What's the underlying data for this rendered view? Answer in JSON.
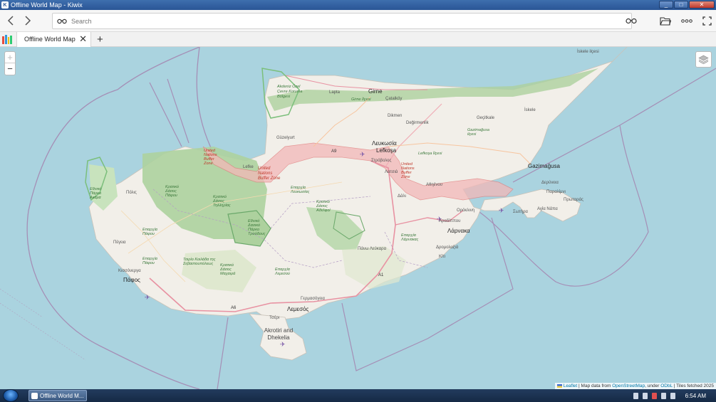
{
  "window": {
    "title": "Offline World Map - Kiwix"
  },
  "toolbar": {
    "search_placeholder": "Search"
  },
  "tabs": [
    {
      "label": "Offline World Map"
    }
  ],
  "map": {
    "zoom_in": "+",
    "zoom_out": "−",
    "attribution": {
      "leaflet": "Leaflet",
      "sep1": " | Map data from ",
      "osm": "OpenStreetMap",
      "sep2": ", under ",
      "odbl": "ODbL",
      "tail": " | Tiles fetched 2025"
    },
    "labels": {
      "girne": "Girne",
      "girne_ilcesi": "Girne İlçesi",
      "lapta": "Lapta",
      "catalkoy": "Çatalköy",
      "iskele_ilcesi": "İskele ilçesi",
      "iskele": "İskele",
      "gecitkale": "Geçitkale",
      "dikmen": "Dikmen",
      "degirmenlik": "Değirmenlik",
      "gazimagusa_ilcesi": "Gazimağusa ilçesi",
      "guzelyurt": "Güzelyurt",
      "akdeniz": "Akdeniz Özel Çevre Koruma Bölgesi",
      "lefkosia_gr": "Λευκωσία",
      "lefkosa": "Lefkoşa",
      "lefkosa_ilcesi": "Lefkoşa İlçesi",
      "strovolos": "Στρόβολος",
      "gazimagusa": "Gazimağusa",
      "dherynia": "Δερύνεια",
      "paralimni": "Παραλίμνι",
      "protaras": "Πρωταράς",
      "ayia_napa": "Αγία Νάπα",
      "sotira": "Σωτήρα",
      "orokleni": "Ορόκλινη",
      "larnaka": "Λάρνακα",
      "lefka": "Lefke",
      "un_buffer_1": "United Nations Buffer Zone",
      "un_buffer_2": "United Nations Buffer Zone",
      "un_buffer_3": "United Nations Buffer Zone",
      "eparchia_lefkosias": "Επαρχία Λευκωσίας",
      "eparchia_pafou": "Επαρχία Πάφου",
      "eparchia_larnakas": "Επαρχία Λάρνακας",
      "eparchia_lemesou": "Επαρχία Λεμεσού",
      "polis": "Πόλις",
      "pegeia": "Πέγεια",
      "pafos": "Πάφος",
      "kissonerga": "Κισσόνεργα",
      "lemesos": "Λεμεσός",
      "germasogeia": "Γερμασόγεια",
      "akrotiri": "Akrotiri and Dhekelia",
      "tseri": "Τσέρι",
      "dali": "Δάλι",
      "aradippou": "Αραδίππου",
      "dromolaxia": "Δρομολαξιά",
      "kiti": "Κίτι",
      "pano_lefkara": "Πάνω Λεύκαρα",
      "athienou": "Αθηένου",
      "latsia": "Λατσιά",
      "a1": "A1",
      "a6": "A6",
      "a9": "A9",
      "troodos": "Εθνικό Δασικό Πάρκο Τροόδους",
      "pafos_forest": "Κρατικό Δάσος Πάφου",
      "akamas": "Εθνικό Πάρκο Ακάμα",
      "tylliria": "Κρατικό Δάσος Τηλληρίας",
      "adelfoi": "Κρατικό Δάσος Αδελφοί",
      "tsada": "Επαρχία Πάφου",
      "mesaoria": "Κρατικό Δάσος Μαχαιρά",
      "kolossi": "Τσιρίο Κοιλάδα της Σεβαστουπόλεως"
    }
  },
  "taskbar": {
    "app_label": "Offline World M...",
    "time": "6:54 AM"
  },
  "colors": {
    "sea": "#aad3df",
    "land": "#f2efe9",
    "forest": "#add19e",
    "buffer": "#f3b8b8",
    "border": "#a095b5"
  }
}
